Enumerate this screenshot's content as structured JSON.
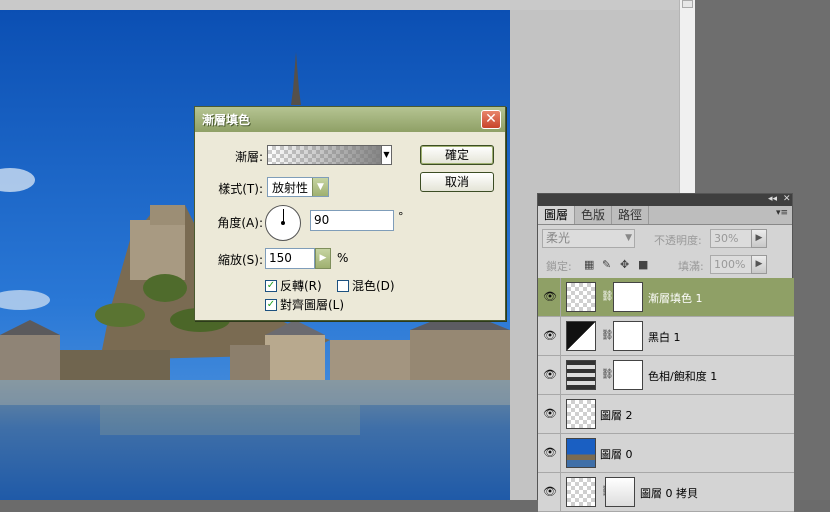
{
  "dialog": {
    "title": "漸層填色",
    "close_label": "✕",
    "gradient_label": "漸層:",
    "style_label": "樣式(T):",
    "style_value": "放射性",
    "angle_label": "角度(A):",
    "angle_value": "90",
    "angle_unit": "°",
    "scale_label": "縮放(S):",
    "scale_value": "150",
    "scale_unit": "%",
    "reverse_label": "反轉(R)",
    "reverse_checked": true,
    "dither_label": "混色(D)",
    "dither_checked": false,
    "align_label": "對齊圖層(L)",
    "align_checked": true,
    "ok_label": "確定",
    "cancel_label": "取消"
  },
  "panel": {
    "tabs": [
      "圖層",
      "色版",
      "路徑"
    ],
    "blend_mode": "柔光",
    "opacity_label": "不透明度:",
    "opacity_value": "30%",
    "lock_label": "鎖定:",
    "fill_label": "填滿:",
    "fill_value": "100%",
    "layers": [
      {
        "name": "漸層填色 1",
        "selected": true
      },
      {
        "name": "黑白 1",
        "selected": false
      },
      {
        "name": "色相/飽和度 1",
        "selected": false
      },
      {
        "name": "圖層 2",
        "selected": false
      },
      {
        "name": "圖層 0",
        "selected": false
      },
      {
        "name": "圖層 0 拷貝",
        "selected": false
      }
    ]
  },
  "colors": {
    "title_bar": "#8fa066",
    "selected_layer": "#8fa066",
    "sky": "#1a5fc2"
  }
}
